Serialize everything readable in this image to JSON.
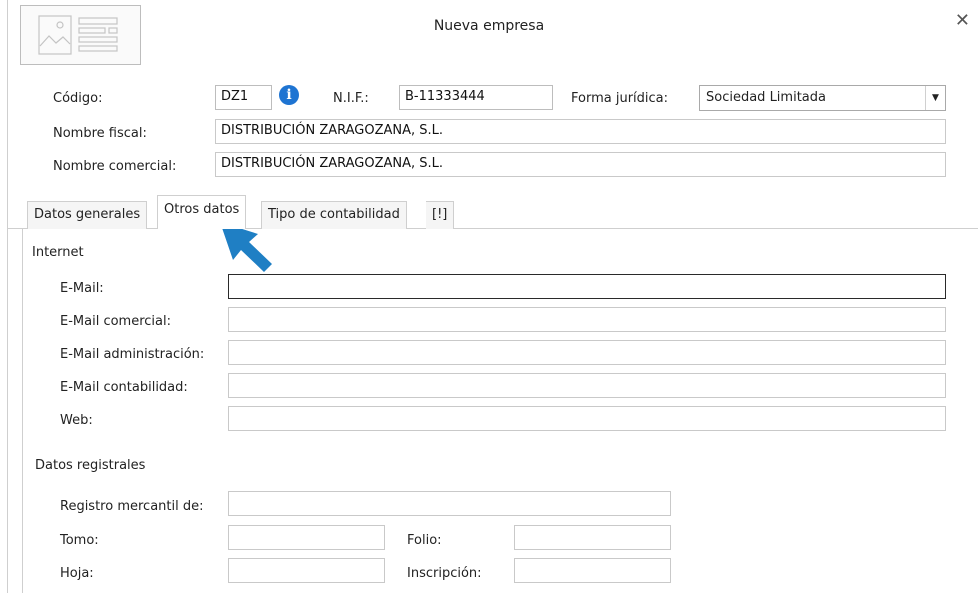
{
  "window": {
    "title": "Nueva empresa",
    "close_label": "✕"
  },
  "header": {
    "codigo_label": "Código:",
    "codigo_value": "DZ1",
    "nif_label": "N.I.F.:",
    "nif_value": "B-11333444",
    "forma_label": "Forma jurídica:",
    "forma_value": "Sociedad Limitada",
    "nombre_fiscal_label": "Nombre fiscal:",
    "nombre_fiscal_value": "DISTRIBUCIÓN ZARAGOZANA, S.L.",
    "nombre_comercial_label": "Nombre comercial:",
    "nombre_comercial_value": "DISTRIBUCIÓN ZARAGOZANA, S.L."
  },
  "tabs": [
    {
      "label": "Datos generales",
      "active": false
    },
    {
      "label": "Otros datos",
      "active": true
    },
    {
      "label": "Tipo de contabilidad",
      "active": false
    },
    {
      "label": "[!]",
      "active": false
    }
  ],
  "internet": {
    "title": "Internet",
    "email_label": "E-Mail:",
    "email_value": "",
    "email_comercial_label": "E-Mail comercial:",
    "email_comercial_value": "",
    "email_admin_label": "E-Mail administración:",
    "email_admin_value": "",
    "email_contab_label": "E-Mail contabilidad:",
    "email_contab_value": "",
    "web_label": "Web:",
    "web_value": ""
  },
  "registrales": {
    "title": "Datos registrales",
    "registro_label": "Registro mercantil de:",
    "registro_value": "",
    "tomo_label": "Tomo:",
    "tomo_value": "",
    "folio_label": "Folio:",
    "folio_value": "",
    "hoja_label": "Hoja:",
    "hoja_value": "",
    "inscripcion_label": "Inscripción:",
    "inscripcion_value": ""
  },
  "icons": {
    "logo_placeholder": "image-placeholder-icon",
    "info": "info-icon",
    "dropdown": "chevron-down-icon",
    "pointer": "arrow-pointer-icon"
  },
  "colors": {
    "info_blue": "#1e74d2",
    "pointer_blue": "#1f7fc4"
  }
}
